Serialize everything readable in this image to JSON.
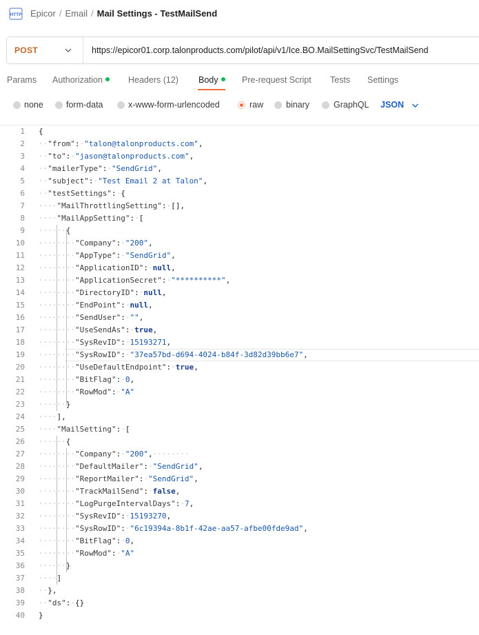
{
  "breadcrumb": {
    "part1": "Epicor",
    "part2": "Email",
    "current": "Mail Settings - TestMailSend"
  },
  "request": {
    "method": "POST",
    "url": "https://epicor01.corp.talonproducts.com/pilot/api/v1/Ice.BO.MailSettingSvc/TestMailSend"
  },
  "tabs": [
    "Params",
    "Authorization",
    "Headers (12)",
    "Body",
    "Pre-request Script",
    "Tests",
    "Settings"
  ],
  "active_tab": "Body",
  "body_types": [
    "none",
    "form-data",
    "x-www-form-urlencoded",
    "raw",
    "binary",
    "GraphQL"
  ],
  "selected_body_type": "raw",
  "format": "JSON",
  "colors": {
    "accent": "#f26b3a",
    "method": "#c0682b",
    "link": "#1b61c9",
    "status_dot": "#0cbb52"
  },
  "code_lines": [
    "{",
    "  \"from\": \"talon@talonproducts.com\",",
    "  \"to\": \"jason@talonproducts.com\",",
    "  \"mailerType\": \"SendGrid\",",
    "  \"subject\": \"Test Email 2 at Talon\",",
    "  \"testSettings\": {",
    "    \"MailThrottlingSetting\": [],",
    "    \"MailAppSetting\": [",
    "      {",
    "        \"Company\": \"200\",",
    "        \"AppType\": \"SendGrid\",",
    "        \"ApplicationID\": null,",
    "        \"ApplicationSecret\": \"**********\",",
    "        \"DirectoryID\": null,",
    "        \"EndPoint\": null,",
    "        \"SendUser\": \"\",",
    "        \"UseSendAs\": true,",
    "        \"SysRevID\": 15193271,",
    "        \"SysRowID\": \"37ea57bd-d694-4024-b84f-3d82d39bb6e7\",",
    "        \"UseDefaultEndpoint\": true,",
    "        \"BitFlag\": 0,",
    "        \"RowMod\": \"A\"",
    "      }",
    "    ],",
    "    \"MailSetting\": [",
    "      {",
    "        \"Company\": \"200\",        ",
    "        \"DefaultMailer\": \"SendGrid\",",
    "        \"ReportMailer\": \"SendGrid\",",
    "        \"TrackMailSend\": false,",
    "        \"LogPurgeIntervalDays\": 7,",
    "        \"SysRevID\": 15193270,",
    "        \"SysRowID\": \"6c19394a-8b1f-42ae-aa57-afbe00fde9ad\",",
    "        \"BitFlag\": 0,",
    "        \"RowMod\": \"A\"",
    "      }",
    "    ]",
    "  },",
    "  \"ds\": {}",
    "}"
  ]
}
